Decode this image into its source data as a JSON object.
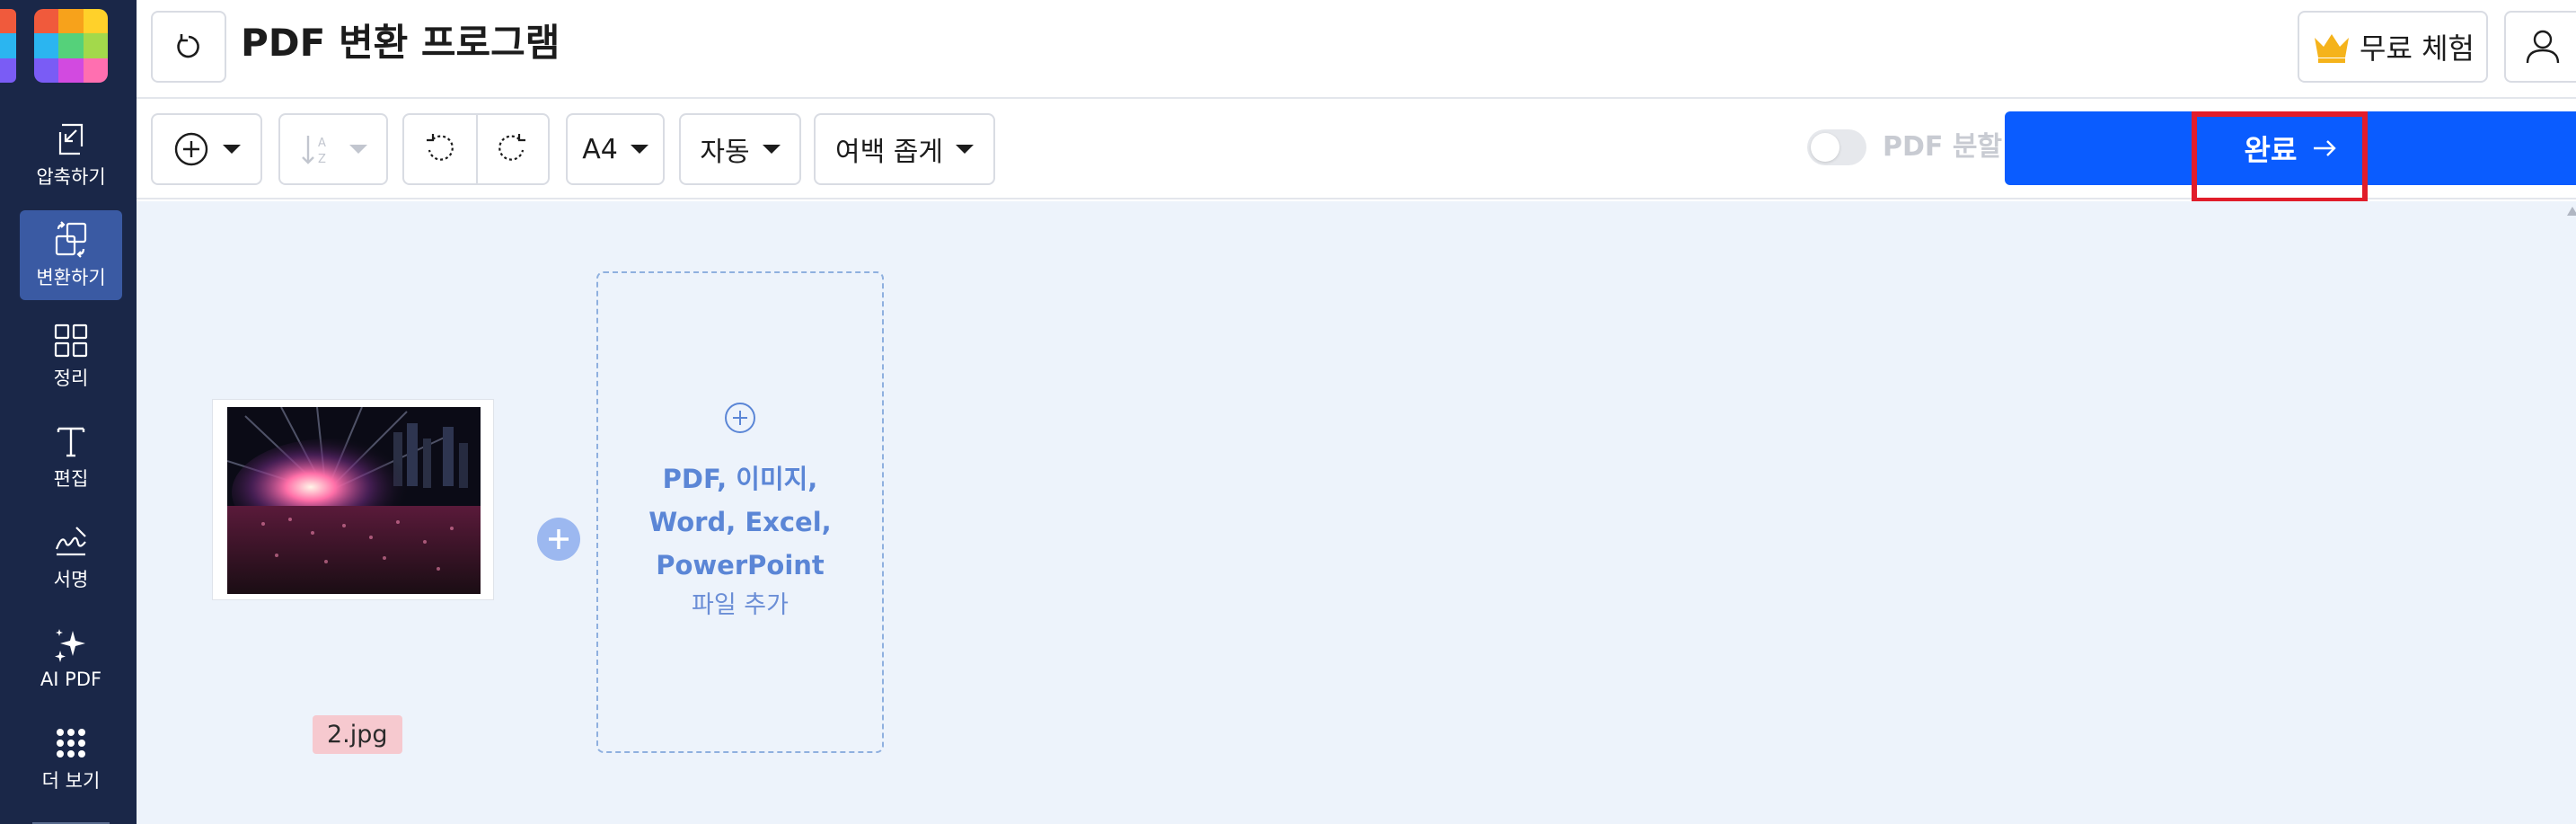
{
  "app": {
    "title": "PDF 변환 프로그램",
    "logo_colors": [
      "#f05a3c",
      "#f7a21b",
      "#ffd12a",
      "#2bb5f0",
      "#55d17a",
      "#a3d94b",
      "#7a5cf5",
      "#d24ae0",
      "#ff6fb0"
    ],
    "accent_color": "#0a5cff",
    "sidebar_bg": "#1a2748"
  },
  "sidebar": {
    "items": [
      {
        "label": "압축하기",
        "icon": "compress-icon",
        "active": false
      },
      {
        "label": "변환하기",
        "icon": "convert-icon",
        "active": true
      },
      {
        "label": "정리",
        "icon": "organize-icon",
        "active": false
      },
      {
        "label": "편집",
        "icon": "edit-text-icon",
        "active": false
      },
      {
        "label": "서명",
        "icon": "signature-icon",
        "active": false
      },
      {
        "label": "AI PDF",
        "icon": "sparkle-icon",
        "active": false
      },
      {
        "label": "더 보기",
        "icon": "more-grid-icon",
        "active": false
      }
    ]
  },
  "header": {
    "trial_label": "무료 체험"
  },
  "toolbar": {
    "page_size": "A4",
    "orientation": "자동",
    "margin": "여백 좁게",
    "split_label": "PDF 분할",
    "split_enabled": false,
    "done_label": "완료"
  },
  "workspace": {
    "files": [
      {
        "name": "2.jpg"
      }
    ],
    "drop_zone": {
      "line1": "PDF, 이미지,",
      "line2": "Word, Excel,",
      "line3": "PowerPoint",
      "sub": "파일 추가"
    }
  }
}
